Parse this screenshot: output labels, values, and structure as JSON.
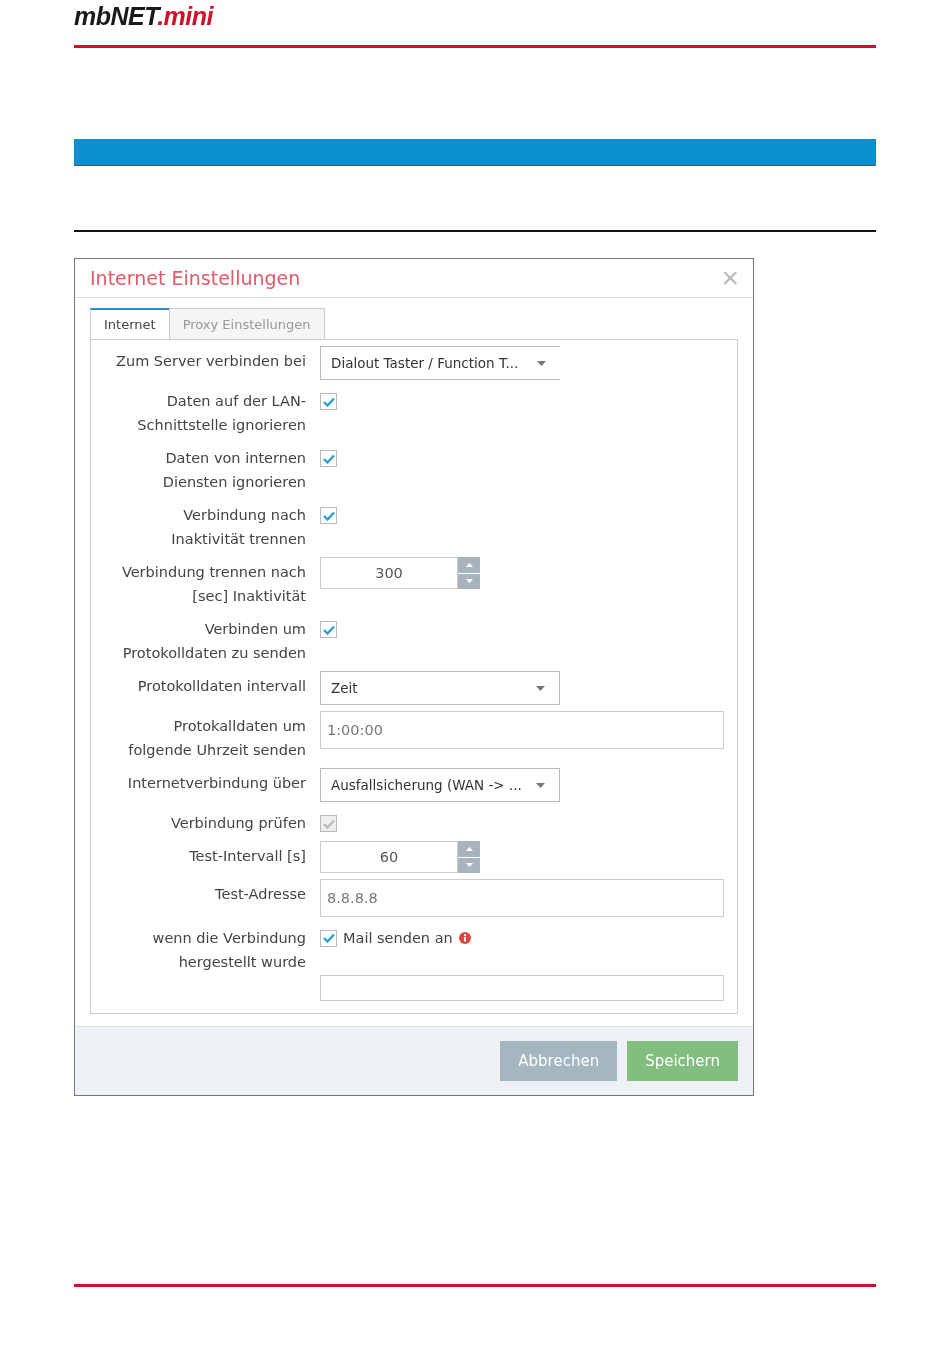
{
  "logo": {
    "main": "mbNET",
    "accent": ".mini"
  },
  "dialog": {
    "title": "Internet Einstellungen",
    "close": "×",
    "tabs": [
      {
        "label": "Internet",
        "selected": true
      },
      {
        "label": "Proxy Einstellungen",
        "selected": false
      }
    ],
    "rows": [
      {
        "kind": "select",
        "label": "Zum Server verbinden bei",
        "value": "Dialout Taster / Function T...",
        "wide": false
      },
      {
        "kind": "checkbox",
        "label": "Daten auf der LAN-\nSchnittstelle ignorieren",
        "checked": true,
        "disabled": false
      },
      {
        "kind": "checkbox",
        "label": "Daten von internen\nDiensten ignorieren",
        "checked": true,
        "disabled": false
      },
      {
        "kind": "checkbox",
        "label": "Verbindung nach\nInaktivität trennen",
        "checked": true,
        "disabled": false
      },
      {
        "kind": "spinner",
        "label": "Verbindung trennen nach\n[sec] Inaktivität",
        "value": "300"
      },
      {
        "kind": "checkbox",
        "label": "Verbinden um\nProtokolldaten zu senden",
        "checked": true,
        "disabled": false
      },
      {
        "kind": "select",
        "label": "Protokolldaten intervall",
        "value": "Zeit",
        "wide": true
      },
      {
        "kind": "text",
        "label": "Protokalldaten um\nfolgende Uhrzeit senden",
        "value": "1:00:00"
      },
      {
        "kind": "select",
        "label": "Internetverbindung über",
        "value": "Ausfallsicherung (WAN -> ...",
        "wide": true
      },
      {
        "kind": "checkbox",
        "label": "Verbindung prüfen",
        "checked": true,
        "disabled": true
      },
      {
        "kind": "spinner",
        "label": "Test-Intervall [s]",
        "value": "60"
      },
      {
        "kind": "text",
        "label": "Test-Adresse",
        "value": "8.8.8.8"
      },
      {
        "kind": "mail",
        "label": "wenn die Verbindung\nhergestellt wurde",
        "checked": true,
        "option": "Mail senden an",
        "value": ""
      }
    ],
    "buttons": [
      {
        "label": "Abbrechen",
        "kind": "cancel"
      },
      {
        "label": "Speichern",
        "kind": "save"
      }
    ]
  }
}
